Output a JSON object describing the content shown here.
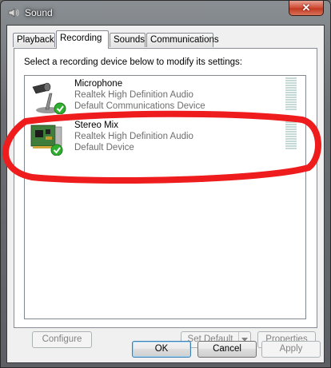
{
  "window": {
    "title": "Sound",
    "close_label": "✕"
  },
  "tabs": [
    {
      "label": "Playback",
      "active": false
    },
    {
      "label": "Recording",
      "active": true
    },
    {
      "label": "Sounds",
      "active": false
    },
    {
      "label": "Communications",
      "active": false
    }
  ],
  "panel": {
    "instructions": "Select a recording device below to modify its settings:",
    "devices": [
      {
        "name": "Microphone",
        "driver": "Realtek High Definition Audio",
        "status": "Default Communications Device",
        "icon": "microphone-icon",
        "badge": "green-check-icon"
      },
      {
        "name": "Stereo Mix",
        "driver": "Realtek High Definition Audio",
        "status": "Default Device",
        "icon": "sound-card-icon",
        "badge": "green-check-icon"
      }
    ],
    "buttons": {
      "configure": "Configure",
      "set_default": "Set Default",
      "properties": "Properties"
    }
  },
  "footer": {
    "ok": "OK",
    "cancel": "Cancel",
    "apply": "Apply"
  },
  "colors": {
    "annotation": "#ee1c1c",
    "check": "#2fae2f",
    "meter": "#c5d9d6"
  }
}
